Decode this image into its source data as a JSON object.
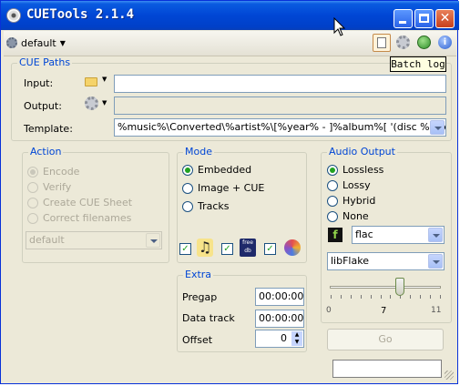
{
  "window": {
    "title": "CUETools 2.1.4"
  },
  "toolbar": {
    "profile": "default",
    "tooltip": "Batch log"
  },
  "cue_paths": {
    "legend": "CUE Paths",
    "input_label": "Input:",
    "output_label": "Output:",
    "template_label": "Template:",
    "input_value": "",
    "output_value": "",
    "template_value": "%music%\\Converted\\%artist%\\[%year% - ]%album%[ '(disc %discnumber%)']"
  },
  "action": {
    "legend": "Action",
    "options": [
      "Encode",
      "Verify",
      "Create CUE Sheet",
      "Correct filenames"
    ],
    "selected": "Encode",
    "script_value": "default"
  },
  "mode": {
    "legend": "Mode",
    "options": [
      "Embedded",
      "Image + CUE",
      "Tracks"
    ],
    "selected": "Embedded"
  },
  "extra": {
    "legend": "Extra",
    "pregap_label": "Pregap",
    "pregap_value": "00:00:00",
    "data_track_label": "Data track",
    "data_track_value": "00:00:00",
    "offset_label": "Offset",
    "offset_value": "0"
  },
  "audio_output": {
    "legend": "Audio Output",
    "options": [
      "Lossless",
      "Lossy",
      "Hybrid",
      "None"
    ],
    "selected": "Lossless",
    "format": "flac",
    "encoder": "libFlake",
    "slider_min": "0",
    "slider_value": "7",
    "slider_max": "11",
    "slider_level": 7
  },
  "go_button": "Go"
}
